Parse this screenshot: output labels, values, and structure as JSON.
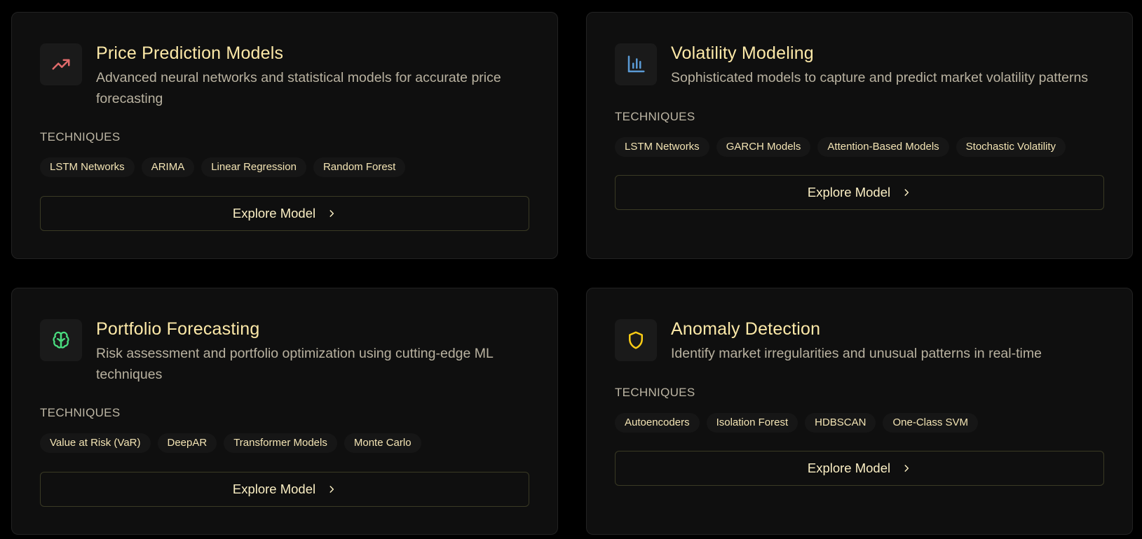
{
  "theme": {
    "background": "#000000",
    "card_background": "#0f0f0f",
    "title_color": "#fde9a8",
    "accent_red": "#e06b6b",
    "accent_blue": "#5b9bd5",
    "accent_green": "#4ade80",
    "accent_yellow": "#facc15"
  },
  "cards": [
    {
      "icon": "trending-up-icon",
      "title": "Price Prediction Models",
      "description_line1": "Advanced neural networks and statistical models for accurate price",
      "description_line2": "forecasting",
      "techniques_label": "TECHNIQUES",
      "techniques": [
        "LSTM Networks",
        "ARIMA",
        "Linear Regression",
        "Random Forest"
      ],
      "cta": "Explore Model"
    },
    {
      "icon": "bar-chart-icon",
      "title": "Volatility Modeling",
      "description_line1": "Sophisticated models to capture and predict market volatility patterns",
      "description_line2": "",
      "techniques_label": "TECHNIQUES",
      "techniques": [
        "LSTM Networks",
        "GARCH Models",
        "Attention-Based Models",
        "Stochastic Volatility"
      ],
      "cta": "Explore Model"
    },
    {
      "icon": "brain-icon",
      "title": "Portfolio Forecasting",
      "description_line1": "Risk assessment and portfolio optimization using cutting-edge ML",
      "description_line2": "techniques",
      "techniques_label": "TECHNIQUES",
      "techniques": [
        "Value at Risk (VaR)",
        "DeepAR",
        "Transformer Models",
        "Monte Carlo"
      ],
      "cta": "Explore Model"
    },
    {
      "icon": "shield-icon",
      "title": "Anomaly Detection",
      "description_line1": "Identify market irregularities and unusual patterns in real-time",
      "description_line2": "",
      "techniques_label": "TECHNIQUES",
      "techniques": [
        "Autoencoders",
        "Isolation Forest",
        "HDBSCAN",
        "One-Class SVM"
      ],
      "cta": "Explore Model"
    }
  ]
}
